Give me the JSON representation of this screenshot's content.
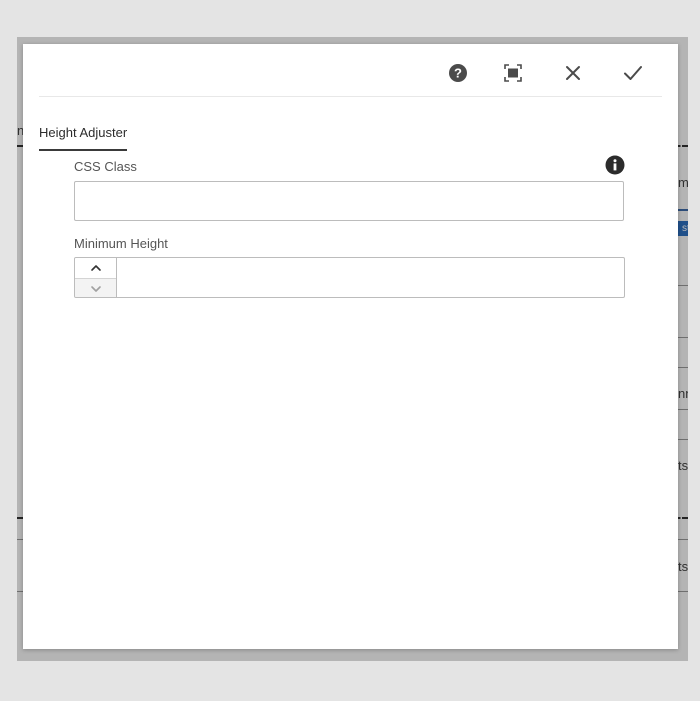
{
  "background": {
    "fragments": [
      "n",
      "m",
      "st",
      "nn",
      "ts",
      "ts"
    ]
  },
  "dialog": {
    "header": {
      "help_icon": "help-circle-icon",
      "fullscreen_icon": "fullscreen-icon",
      "close_icon": "close-icon",
      "done_icon": "checkmark-icon"
    },
    "tabs": [
      {
        "label": "Height Adjuster",
        "active": true
      }
    ],
    "fields": {
      "css_class": {
        "label": "CSS Class",
        "value": "",
        "placeholder": "",
        "info_icon": "info-icon"
      },
      "min_height": {
        "label": "Minimum Height",
        "value": "",
        "placeholder": ""
      }
    }
  },
  "colors": {
    "overlay": "#9e9e9e",
    "accent_chip": "#2d6fc0",
    "icon": "#4b4b4b"
  }
}
